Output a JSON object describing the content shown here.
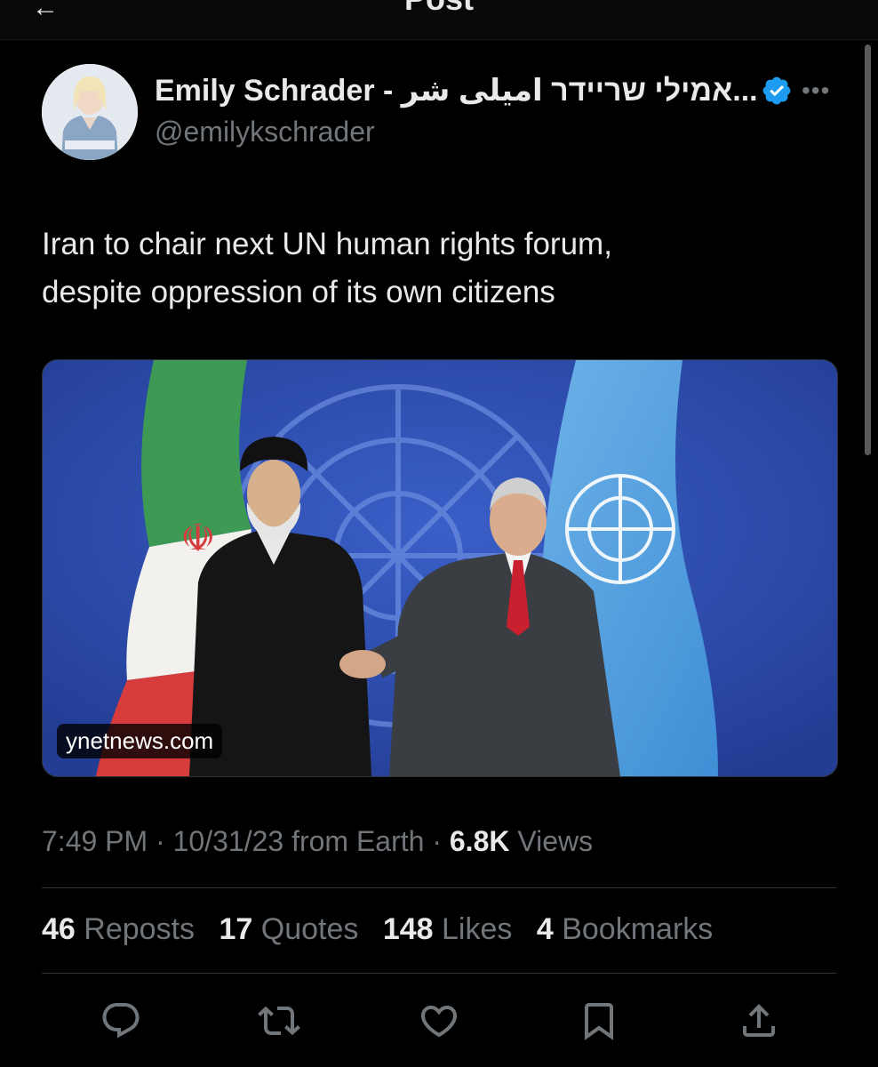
{
  "header": {
    "title": "Post"
  },
  "author": {
    "name": "Emily Schrader - אמילי שריידר امیلی شر...",
    "handle": "@emilykschrader",
    "verified": true
  },
  "tweet": {
    "text_line1": "Iran to chair next UN human rights forum,",
    "text_line2": "despite oppression of its own citizens"
  },
  "media": {
    "source": "ynetnews.com"
  },
  "meta": {
    "time": "7:49 PM",
    "date": "10/31/23",
    "from": "from Earth",
    "sep": "·",
    "views_count": "6.8K",
    "views_label": "Views"
  },
  "stats": {
    "reposts": {
      "count": "46",
      "label": "Reposts"
    },
    "quotes": {
      "count": "17",
      "label": "Quotes"
    },
    "likes": {
      "count": "148",
      "label": "Likes"
    },
    "bookmarks": {
      "count": "4",
      "label": "Bookmarks"
    }
  },
  "actions": [
    "reply-icon",
    "repost-icon",
    "like-icon",
    "bookmark-icon",
    "share-icon"
  ],
  "colors": {
    "background": "#000000",
    "text_primary": "#e7e9ea",
    "text_secondary": "#71767b",
    "verified": "#1d9bf0",
    "divider": "#2f3336"
  }
}
